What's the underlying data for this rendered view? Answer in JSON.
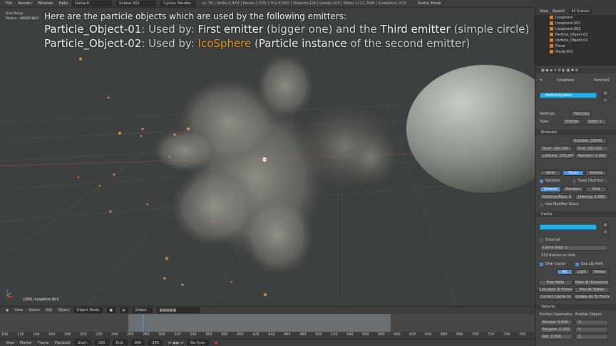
{
  "topbar": {
    "menu": [
      "File",
      "Render",
      "Window",
      "Help"
    ],
    "layout": "Default",
    "scene": "Scene.001",
    "engine": "Cycles Render",
    "stats": "v2.78 | Verts:2,474 | Faces:2,535 | Tris:4,650 | Objects:1/8 | Lamps:0/0 | Mem:1311.30M | Icosphere.003",
    "demo": "Demo Mode"
  },
  "viewport": {
    "view_name": "User Persp",
    "units": "Meters : UNDEFINED",
    "caption_line1": "Here are the particle objects which are used by the following emitters:",
    "line2_name": "Particle_Object-01",
    "line2_used": ": Used by: ",
    "line2_first": "First emitter",
    "line2_bigger": " (bigger one) and the ",
    "line2_third": "Third emitter",
    "line2_simple": " (simple circle)",
    "line3_name": "Particle_Object-02",
    "line3_used": ": Used by: ",
    "line3_ico": "IcoSphere",
    "line3_paren_open": " (",
    "line3_instance": "Particle instance",
    "line3_rest": " of the second emitter)",
    "object_label": "(280) Icosphere.003",
    "colors": {
      "highlight": "#f0a030",
      "text": "#ffffff"
    }
  },
  "vpheader": {
    "items": [
      "View",
      "Select",
      "Add",
      "Object"
    ],
    "mode": "Object Mode",
    "orientation": "Global"
  },
  "timeline": {
    "ticks": [
      "100",
      "120",
      "140",
      "160",
      "180",
      "200",
      "220",
      "240",
      "260",
      "280",
      "300",
      "320",
      "340",
      "360",
      "380",
      "400",
      "420",
      "440",
      "460",
      "480",
      "500",
      "520",
      "540",
      "560",
      "580",
      "600",
      "620",
      "640",
      "660",
      "680",
      "700",
      "720",
      "740",
      "760"
    ]
  },
  "footer": {
    "items": [
      "View",
      "Marker",
      "Frame",
      "Playback"
    ],
    "start": "Start:",
    "start_val": "260",
    "end": "End:",
    "end_val": "800",
    "current": "280",
    "sync": "No Sync"
  },
  "outliner": {
    "tabs": [
      "View",
      "Search",
      "All Scenes"
    ],
    "rows": [
      "Icosphere",
      "Icosphere.001",
      "Icosphere.002",
      "Particle_Object-01",
      "Particle_Object-02",
      "Plane",
      "Plane.001"
    ]
  },
  "props": {
    "context": "Icosphere",
    "tab_particles": "ParticleS",
    "system_name": "ParticleSystem",
    "settings_label": "Settings:",
    "settings_value": "Particles",
    "type_label": "Type:",
    "type_value": "Emitter",
    "seed_label": "Seed: 0",
    "emission": "Emission",
    "number": "Number: 20000",
    "start": "Start: 260.000",
    "end": "End: 280.000",
    "lifetime": "Lifetime: 250.000",
    "random": "Random: 0.000",
    "emit_from": [
      "Verts",
      "Faces",
      "Volume"
    ],
    "random_chk": "Random",
    "even_dist": "Even Distribut...",
    "dist_modes": [
      "Jittered",
      "Random",
      "Grid"
    ],
    "particles_face": "Particles/Face: 0",
    "jittering": "Jittering: 1.000",
    "use_modifier": "Use Modifier Stack",
    "cache": "Cache",
    "external": "External",
    "cache_step": "Cache Step: 1",
    "frames_on_disk": "332 frames on disk",
    "disk_cache": "Disk Cache",
    "use_lib_path": "Use Lib Path",
    "compress": "Compress:",
    "compress_modes": [
      "No",
      "Light",
      "Heavy"
    ],
    "free_bake": "Free Bake",
    "bake_all": "Bake All Dynamics",
    "calc_to_frame": "Calculate To Frame",
    "free_all": "Free All Bakes",
    "current_cache": "Current Cache to",
    "update_all": "Update All To Frame",
    "velocity": "Velocity",
    "emitter_geometry": "Emitter Geometry:",
    "emitter_object": "Emitter Object:",
    "normal": "Normal: 0.000",
    "tangent": "Tangent: 0.000",
    "rot": "Rot: 0.000",
    "x": "X:",
    "y": "Y:",
    "z": "Z:"
  }
}
